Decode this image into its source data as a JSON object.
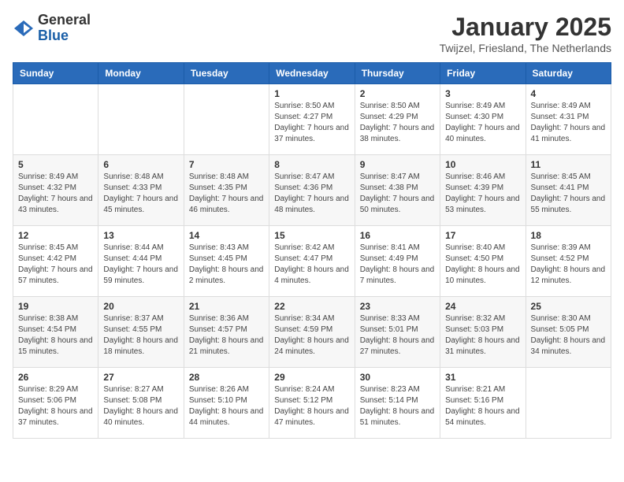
{
  "logo": {
    "general": "General",
    "blue": "Blue"
  },
  "header": {
    "month": "January 2025",
    "location": "Twijzel, Friesland, The Netherlands"
  },
  "weekdays": [
    "Sunday",
    "Monday",
    "Tuesday",
    "Wednesday",
    "Thursday",
    "Friday",
    "Saturday"
  ],
  "weeks": [
    [
      {
        "day": "",
        "info": ""
      },
      {
        "day": "",
        "info": ""
      },
      {
        "day": "",
        "info": ""
      },
      {
        "day": "1",
        "info": "Sunrise: 8:50 AM\nSunset: 4:27 PM\nDaylight: 7 hours and 37 minutes."
      },
      {
        "day": "2",
        "info": "Sunrise: 8:50 AM\nSunset: 4:29 PM\nDaylight: 7 hours and 38 minutes."
      },
      {
        "day": "3",
        "info": "Sunrise: 8:49 AM\nSunset: 4:30 PM\nDaylight: 7 hours and 40 minutes."
      },
      {
        "day": "4",
        "info": "Sunrise: 8:49 AM\nSunset: 4:31 PM\nDaylight: 7 hours and 41 minutes."
      }
    ],
    [
      {
        "day": "5",
        "info": "Sunrise: 8:49 AM\nSunset: 4:32 PM\nDaylight: 7 hours and 43 minutes."
      },
      {
        "day": "6",
        "info": "Sunrise: 8:48 AM\nSunset: 4:33 PM\nDaylight: 7 hours and 45 minutes."
      },
      {
        "day": "7",
        "info": "Sunrise: 8:48 AM\nSunset: 4:35 PM\nDaylight: 7 hours and 46 minutes."
      },
      {
        "day": "8",
        "info": "Sunrise: 8:47 AM\nSunset: 4:36 PM\nDaylight: 7 hours and 48 minutes."
      },
      {
        "day": "9",
        "info": "Sunrise: 8:47 AM\nSunset: 4:38 PM\nDaylight: 7 hours and 50 minutes."
      },
      {
        "day": "10",
        "info": "Sunrise: 8:46 AM\nSunset: 4:39 PM\nDaylight: 7 hours and 53 minutes."
      },
      {
        "day": "11",
        "info": "Sunrise: 8:45 AM\nSunset: 4:41 PM\nDaylight: 7 hours and 55 minutes."
      }
    ],
    [
      {
        "day": "12",
        "info": "Sunrise: 8:45 AM\nSunset: 4:42 PM\nDaylight: 7 hours and 57 minutes."
      },
      {
        "day": "13",
        "info": "Sunrise: 8:44 AM\nSunset: 4:44 PM\nDaylight: 7 hours and 59 minutes."
      },
      {
        "day": "14",
        "info": "Sunrise: 8:43 AM\nSunset: 4:45 PM\nDaylight: 8 hours and 2 minutes."
      },
      {
        "day": "15",
        "info": "Sunrise: 8:42 AM\nSunset: 4:47 PM\nDaylight: 8 hours and 4 minutes."
      },
      {
        "day": "16",
        "info": "Sunrise: 8:41 AM\nSunset: 4:49 PM\nDaylight: 8 hours and 7 minutes."
      },
      {
        "day": "17",
        "info": "Sunrise: 8:40 AM\nSunset: 4:50 PM\nDaylight: 8 hours and 10 minutes."
      },
      {
        "day": "18",
        "info": "Sunrise: 8:39 AM\nSunset: 4:52 PM\nDaylight: 8 hours and 12 minutes."
      }
    ],
    [
      {
        "day": "19",
        "info": "Sunrise: 8:38 AM\nSunset: 4:54 PM\nDaylight: 8 hours and 15 minutes."
      },
      {
        "day": "20",
        "info": "Sunrise: 8:37 AM\nSunset: 4:55 PM\nDaylight: 8 hours and 18 minutes."
      },
      {
        "day": "21",
        "info": "Sunrise: 8:36 AM\nSunset: 4:57 PM\nDaylight: 8 hours and 21 minutes."
      },
      {
        "day": "22",
        "info": "Sunrise: 8:34 AM\nSunset: 4:59 PM\nDaylight: 8 hours and 24 minutes."
      },
      {
        "day": "23",
        "info": "Sunrise: 8:33 AM\nSunset: 5:01 PM\nDaylight: 8 hours and 27 minutes."
      },
      {
        "day": "24",
        "info": "Sunrise: 8:32 AM\nSunset: 5:03 PM\nDaylight: 8 hours and 31 minutes."
      },
      {
        "day": "25",
        "info": "Sunrise: 8:30 AM\nSunset: 5:05 PM\nDaylight: 8 hours and 34 minutes."
      }
    ],
    [
      {
        "day": "26",
        "info": "Sunrise: 8:29 AM\nSunset: 5:06 PM\nDaylight: 8 hours and 37 minutes."
      },
      {
        "day": "27",
        "info": "Sunrise: 8:27 AM\nSunset: 5:08 PM\nDaylight: 8 hours and 40 minutes."
      },
      {
        "day": "28",
        "info": "Sunrise: 8:26 AM\nSunset: 5:10 PM\nDaylight: 8 hours and 44 minutes."
      },
      {
        "day": "29",
        "info": "Sunrise: 8:24 AM\nSunset: 5:12 PM\nDaylight: 8 hours and 47 minutes."
      },
      {
        "day": "30",
        "info": "Sunrise: 8:23 AM\nSunset: 5:14 PM\nDaylight: 8 hours and 51 minutes."
      },
      {
        "day": "31",
        "info": "Sunrise: 8:21 AM\nSunset: 5:16 PM\nDaylight: 8 hours and 54 minutes."
      },
      {
        "day": "",
        "info": ""
      }
    ]
  ]
}
